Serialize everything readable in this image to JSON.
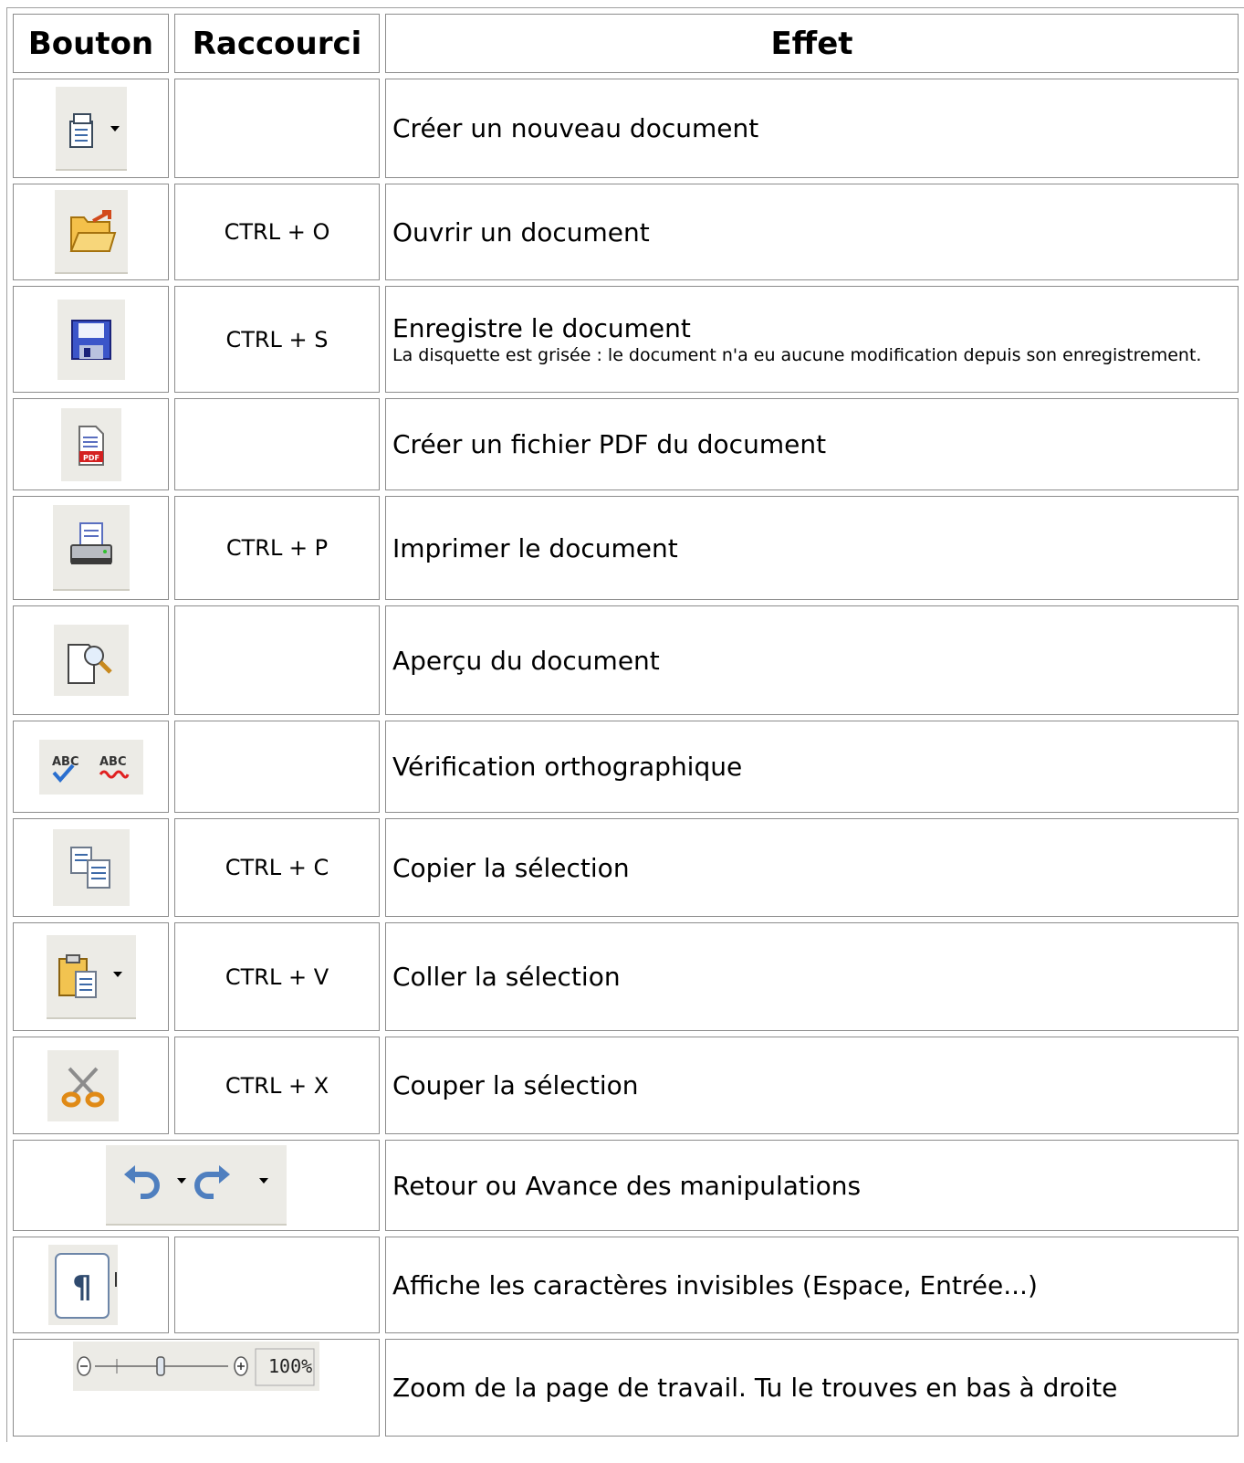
{
  "headers": {
    "button": "Bouton",
    "shortcut": "Raccourci",
    "effect": "Effet"
  },
  "rows": [
    {
      "icon": "new-document-icon",
      "shortcut": "",
      "effect": "Créer un nouveau document",
      "note": ""
    },
    {
      "icon": "open-folder-icon",
      "shortcut": "CTRL + O",
      "effect": "Ouvrir un document",
      "note": ""
    },
    {
      "icon": "floppy-disk-icon",
      "shortcut": "CTRL + S",
      "effect": "Enregistre le document",
      "note": "La disquette est grisée : le document n'a eu aucune modification depuis son enregistrement."
    },
    {
      "icon": "pdf-export-icon",
      "shortcut": "",
      "effect": "Créer un fichier PDF du document",
      "note": ""
    },
    {
      "icon": "printer-icon",
      "shortcut": "CTRL + P",
      "effect": "Imprimer le document",
      "note": ""
    },
    {
      "icon": "print-preview-icon",
      "shortcut": "",
      "effect": "Aperçu du document",
      "note": ""
    },
    {
      "icon": "spellcheck-icon",
      "shortcut": "",
      "effect": "Vérification orthographique",
      "note": ""
    },
    {
      "icon": "copy-icon",
      "shortcut": "CTRL + C",
      "effect": "Copier la sélection",
      "note": ""
    },
    {
      "icon": "paste-icon",
      "shortcut": "CTRL + V",
      "effect": "Coller la sélection",
      "note": ""
    },
    {
      "icon": "scissors-icon",
      "shortcut": "CTRL + X",
      "effect": "Couper la sélection",
      "note": ""
    },
    {
      "icon": "undo-redo-icon",
      "shortcut": "",
      "effect": "Retour ou Avance des manipulations",
      "note": ""
    },
    {
      "icon": "pilcrow-icon",
      "shortcut": "",
      "effect": "Affiche les caractères invisibles (Espace, Entrée...)",
      "note": ""
    },
    {
      "icon": "zoom-slider-icon",
      "shortcut": "",
      "effect": "Zoom de la page de travail. Tu le trouves en bas à droite",
      "note": ""
    }
  ],
  "zoom": {
    "value_label": "100%"
  }
}
